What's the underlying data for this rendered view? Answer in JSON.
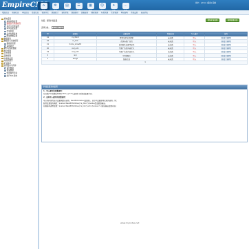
{
  "header": {
    "logo_main": "EmpireCMS",
    "logo_sub": "帝国网站管理系统",
    "user_text": "用户：admin [退出] 系统",
    "top_icons": [
      {
        "label": "首页",
        "icon": "home-icon"
      },
      {
        "label": "系统",
        "icon": "gear-icon"
      },
      {
        "label": "栏目",
        "icon": "folder-icon"
      },
      {
        "label": "信息",
        "icon": "doc-icon"
      },
      {
        "label": "模板",
        "icon": "template-icon"
      },
      {
        "label": "用户",
        "icon": "user-icon"
      },
      {
        "label": "插件",
        "icon": "plugin-icon"
      },
      {
        "label": "其他",
        "icon": "more-icon"
      }
    ],
    "nav": [
      "增加信息",
      "管理信息",
      "审核信息",
      "签发信息",
      "管理评论",
      "数据统计",
      "更新系统",
      "数据备份",
      "数据更新",
      "模板管理",
      "标签管理",
      "栏目管理",
      "网站架构",
      "系统设置",
      "退出系统"
    ]
  },
  "sidebar": {
    "items": [
      {
        "label": "系统设置",
        "level": 0
      },
      {
        "label": "系统参数设置",
        "level": 1
      },
      {
        "label": "数据表与系统模型",
        "level": 1,
        "hl": true
      },
      {
        "label": "自定义页面设置",
        "level": 1
      },
      {
        "label": "SEO优化设置",
        "level": 1
      },
      {
        "label": "扩展变量",
        "level": 1
      },
      {
        "label": "后台左侧菜单",
        "level": 1
      },
      {
        "label": "网站地图设置",
        "level": 1
      },
      {
        "label": "数据更新",
        "level": 0
      },
      {
        "label": "数据表与系统模型",
        "level": 0
      },
      {
        "label": "数据表管理",
        "level": 1
      },
      {
        "label": "系统模型",
        "level": 1
      },
      {
        "label": "备份与恢复数据",
        "level": 0
      },
      {
        "label": "用户管理",
        "level": 0
      },
      {
        "label": "日志管理",
        "level": 0
      },
      {
        "label": "其他管理",
        "level": 0
      },
      {
        "label": "防采集设置",
        "level": 0
      },
      {
        "label": "内容关键字",
        "level": 0
      },
      {
        "label": "扩展菜单",
        "level": 0
      },
      {
        "label": "远程发布与同步",
        "level": 0
      },
      {
        "label": "备份数据",
        "level": 1
      },
      {
        "label": "恢复数据",
        "level": 1
      },
      {
        "label": "管理备份目录",
        "level": 1
      },
      {
        "label": "执行SQL语句",
        "level": 1
      }
    ]
  },
  "main": {
    "breadcrumb": "位置：管理扩展变量",
    "btn_add": "增加扩展变量",
    "btn_manage": "管理变量分类",
    "filter_label": "选择分类：",
    "filter_value": "显示所有分类",
    "columns": [
      "ID",
      "变量名",
      "变量说明",
      "所属分类",
      "写入缓存",
      "操作"
    ],
    "rows": [
      {
        "id": "41",
        "name": "cs_dbnd",
        "desc": "是否显示前台搜索",
        "cat": "未分类",
        "cache": "写入",
        "ops": "[修改] [删除]"
      },
      {
        "id": "42",
        "name": "cs_link",
        "desc": "首页标签广告位",
        "cat": "未分类",
        "cache": "写入",
        "ops": "[修改] [删除]"
      },
      {
        "id": "21",
        "name": "home_showtit",
        "desc": "首页图片标题不显示",
        "cat": "未分类",
        "cache": "写入",
        "ops": "[修改] [删除]"
      },
      {
        "id": "20",
        "name": "red_ad1",
        "desc": "专题广告位内容定义",
        "cat": "未分类",
        "cache": "写入",
        "ops": "[修改] [删除]"
      },
      {
        "id": "19",
        "name": "red_ad3",
        "desc": "专题广告位内容定义",
        "cat": "未分类",
        "cache": "写入",
        "ops": "[修改] [删除]"
      },
      {
        "id": "2",
        "name": "isqi",
        "desc": "QQ客服号",
        "cat": "未分类",
        "cache": "写入",
        "ops": "[修改] [删除]"
      },
      {
        "id": "1",
        "name": "bangt",
        "desc": "版权信息",
        "cat": "未分类",
        "cache": "写入",
        "ops": "[修改] [删除]"
      }
    ],
    "foot_marker": "1"
  },
  "panel": {
    "title": "扩展变量调用说明",
    "lines": [
      {
        "text": "1、写入缓存的变量调用：",
        "bold": true
      },
      {
        "text": "在任意php或模板中用$public_r['add_变量名']来输出变量内容。",
        "bold": false
      },
      {
        "text": "2、没有写入缓存的变量调用：",
        "bold": true
      },
      {
        "text": "可以用内置的显示变量函数来调用，ReadEVarValue(变量名)，显示不变量即用实现的调用。例：",
        "bold": false
      },
      {
        "text": "取得变量值的函数：$value=ReadEVarValue('cs_dbnd');$value是变量值输出。",
        "bold": false
      },
      {
        "text": "在模板中调用变量：$value=ReadEVarValue('cs_link');echo $value;?>(直接输出变量内容)",
        "bold": false
      }
    ]
  },
  "watermark": "www.mycodes.net"
}
